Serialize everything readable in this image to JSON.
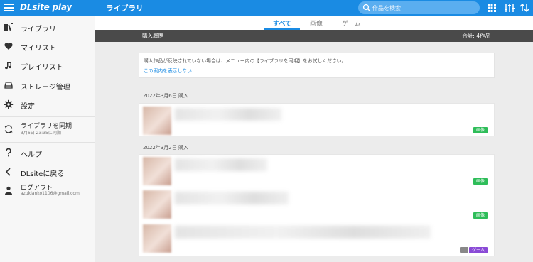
{
  "header": {
    "logo": "DLsite play",
    "title": "ライブラリ",
    "search_placeholder": "作品を検索"
  },
  "sidebar": {
    "items": [
      {
        "label": "ライブラリ",
        "icon": "library-icon"
      },
      {
        "label": "マイリスト",
        "icon": "heart-icon"
      },
      {
        "label": "プレイリスト",
        "icon": "music-note-icon"
      },
      {
        "label": "ストレージ管理",
        "icon": "storage-icon"
      },
      {
        "label": "設定",
        "icon": "gear-icon"
      }
    ],
    "sync": {
      "label": "ライブラリを同期",
      "sub": "3月6日 23:35に同期"
    },
    "help": "ヘルプ",
    "back": "DLsiteに戻る",
    "logout": {
      "label": "ログアウト",
      "email": "azukianko1106@gmail.com"
    }
  },
  "tabs": [
    {
      "label": "すべて",
      "active": true
    },
    {
      "label": "画像",
      "active": false
    },
    {
      "label": "ゲーム",
      "active": false
    }
  ],
  "history_bar": {
    "title": "購入履歴",
    "total": "合計: 4作品"
  },
  "notice": {
    "message": "購入作品が反映されていない場合は、メニュー内の【ライブラリを同期】をお試しください。",
    "dismiss": "この案内を表示しない"
  },
  "groups": [
    {
      "date": "2022年3月6日 購入",
      "items": [
        {
          "badge": "画像"
        }
      ]
    },
    {
      "date": "2022年3月2日 購入",
      "items": [
        {
          "badge": "画像"
        },
        {
          "badge": "画像"
        },
        {
          "badge": "ゲーム"
        }
      ]
    }
  ],
  "colors": {
    "accent": "#1a8be3",
    "badge_image": "#2ebd59",
    "badge_game": "#8a4ad6"
  }
}
